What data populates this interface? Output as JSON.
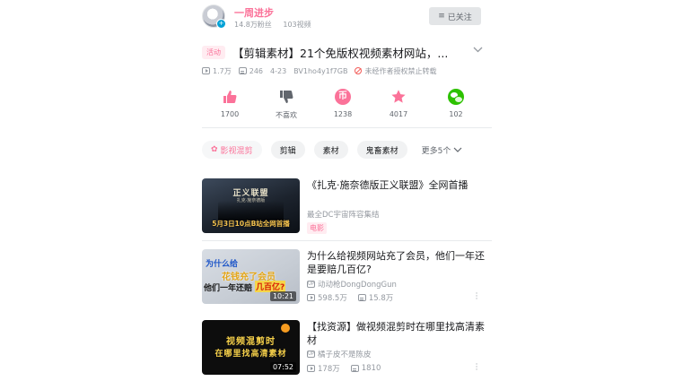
{
  "uploader": {
    "name": "一周进步",
    "fans": "14.8万粉丝",
    "videos": "103视频",
    "follow_label": "已关注",
    "follow_icon": "menu-lines-icon"
  },
  "video": {
    "tag": "活动",
    "title": "【剪辑素材】21个免版权视频素材网站，...",
    "views": "1.7万",
    "danmaku": "246",
    "date": "4-23",
    "bvid": "BV1ho4y1f7GB",
    "notice": "未经作者授权禁止转载"
  },
  "actions": [
    {
      "icon": "thumbs-up-icon",
      "label": "1700"
    },
    {
      "icon": "thumbs-down-icon",
      "label": "不喜欢"
    },
    {
      "icon": "coin-icon",
      "label": "1238"
    },
    {
      "icon": "star-icon",
      "label": "4017"
    },
    {
      "icon": "wechat-icon",
      "label": "102"
    }
  ],
  "chips": [
    "影视混剪",
    "剪辑",
    "素材",
    "鬼畜素材"
  ],
  "more_label": "更多5个",
  "colors": {
    "accent": "#fb7299",
    "text": "#18191c",
    "muted": "#9499a0"
  },
  "list": [
    {
      "title": "《扎克·施奈德版正义联盟》全网首播",
      "subtitle": "最全DC宇宙阵容集结",
      "type_tag": "电影",
      "thumb_title": "正义联盟",
      "thumb_sub": "扎克·施奈德版",
      "thumb_band": "5月3日10点B站全网首播"
    },
    {
      "title": "为什么给视频网站充了会员，他们一年还是要赔几百亿?",
      "author": "动动枪DongDongGun",
      "views": "598.5万",
      "danmaku": "15.8万",
      "duration": "10:21",
      "thumb_line1": "为什么给",
      "thumb_line2": "花钱充了会员",
      "thumb_line3": "他们一年还赔",
      "thumb_line3b": "几百亿?"
    },
    {
      "title": "【找资源】做视频混剪时在哪里找高清素材",
      "author": "橘子皮不是陈皮",
      "views": "178万",
      "danmaku": "1810",
      "duration": "07:52",
      "thumb_line1": "视频混剪时",
      "thumb_line2": "在哪里找高清素材"
    }
  ]
}
